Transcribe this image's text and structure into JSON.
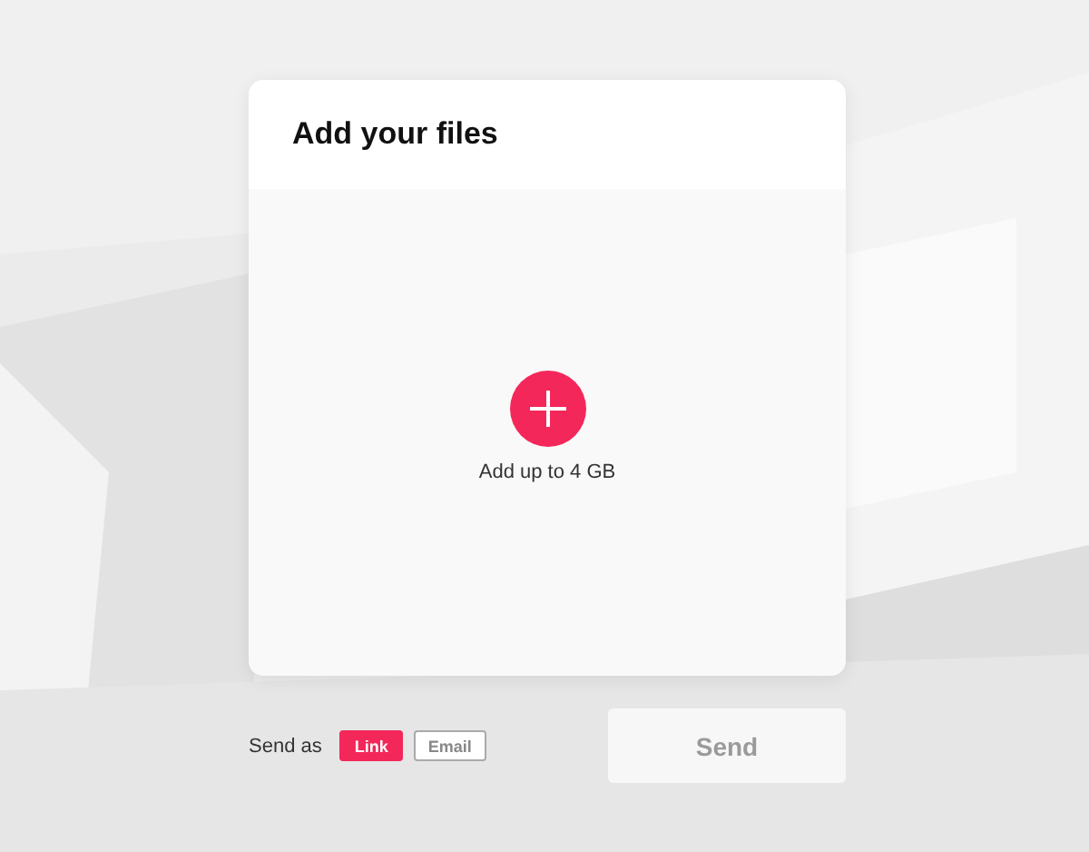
{
  "card": {
    "title": "Add your files",
    "upload_hint": "Add up to 4 GB"
  },
  "send_as": {
    "label": "Send as",
    "options": [
      {
        "label": "Link",
        "selected": true
      },
      {
        "label": "Email",
        "selected": false
      }
    ]
  },
  "send_button": {
    "label": "Send",
    "disabled": true
  }
}
